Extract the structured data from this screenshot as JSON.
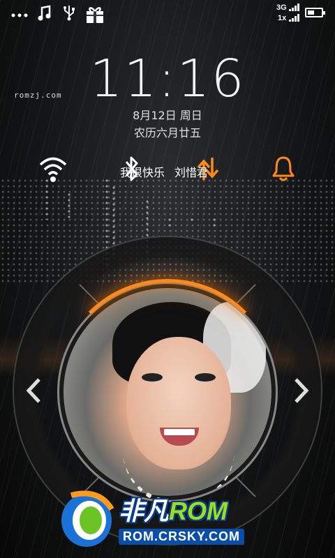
{
  "status_bar": {
    "icons": [
      "more-dots-icon",
      "music-note-icon",
      "usb-icon",
      "gift-icon"
    ],
    "network_top": "3G",
    "network_bottom": "1x",
    "battery_level": 0.5
  },
  "lockscreen": {
    "time": "11:16",
    "date": "8月12日 周日",
    "lunar_date": "农历六月廿五",
    "watermark": "romzj.com"
  },
  "toggles": [
    "wifi-icon",
    "bluetooth-icon",
    "data-sync-icon",
    "bell-icon"
  ],
  "music": {
    "title": "我很快乐",
    "artist": "刘惜君"
  },
  "controls": {
    "prev": "chevron-left-icon",
    "next": "chevron-right-icon"
  },
  "colors": {
    "accent": "#ff8a1a",
    "text": "#ffffff",
    "logo_blue": "#0b4ea8",
    "logo_green": "#9be01a"
  },
  "watermark_logo": {
    "brand_prefix": "非凡",
    "brand_suffix": "ROM",
    "url": "ROM.CRSKY.COM"
  }
}
